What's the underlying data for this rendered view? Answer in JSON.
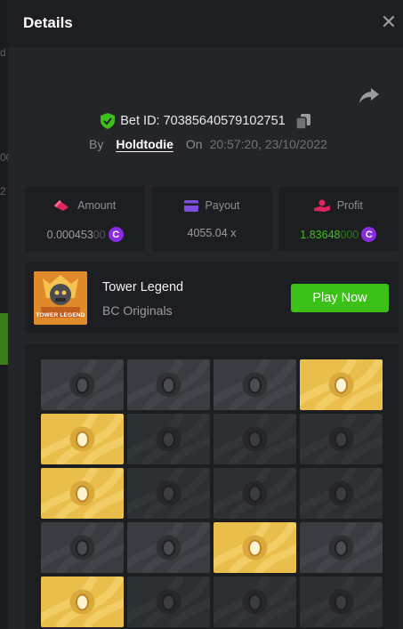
{
  "backdrop": {
    "fragments": [
      "d",
      "00",
      "2"
    ]
  },
  "header": {
    "title": "Details",
    "close_glyph": "✕"
  },
  "bet": {
    "id_label": "Bet ID: 70385640579102751",
    "by_label": "By",
    "username": "Holdtodie",
    "on_label": "On",
    "timestamp": "20:57:20, 23/10/2022"
  },
  "stats": {
    "amount": {
      "label": "Amount",
      "value_main": "0.000453",
      "value_dim": "00"
    },
    "payout": {
      "label": "Payout",
      "value": "4055.04 x"
    },
    "profit": {
      "label": "Profit",
      "value_main": "1.83648",
      "value_dim": "000"
    },
    "currency_glyph": "C"
  },
  "game": {
    "name": "Tower Legend",
    "provider": "BC Originals",
    "thumb_caption": "TOWER LEGEND",
    "play_label": "Play Now"
  },
  "board": {
    "rows": [
      [
        "dark",
        "dark",
        "dark",
        "gold"
      ],
      [
        "gold",
        "dim",
        "dim",
        "dim"
      ],
      [
        "gold",
        "dim",
        "dim",
        "dim"
      ],
      [
        "dark",
        "dark",
        "gold",
        "dark"
      ],
      [
        "gold",
        "dim",
        "dim",
        "dim"
      ]
    ]
  },
  "colors": {
    "accent_green": "#3bc117",
    "gold_tile": "#e9be4b",
    "coin_purple": "#8a2be2",
    "amount_icon": "#e0245e",
    "payout_icon": "#7b4fe0",
    "profit_icon": "#e0245e"
  },
  "icons": [
    "close-icon",
    "share-icon",
    "shield-check-icon",
    "copy-icon",
    "amount-icon",
    "payout-icon",
    "profit-icon",
    "coin-icon",
    "egg-icon"
  ]
}
